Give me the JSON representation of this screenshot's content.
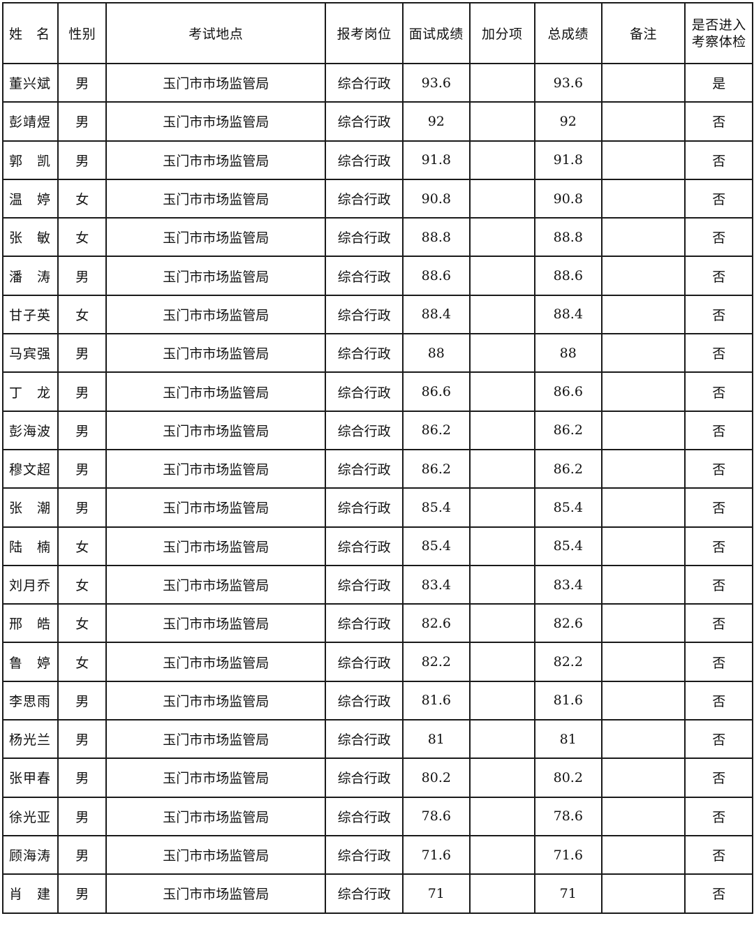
{
  "table": {
    "headers": [
      "姓　名",
      "性别",
      "考试地点",
      "报考岗位",
      "面试成绩",
      "加分项",
      "总成绩",
      "备注",
      "是否进入考察体检"
    ],
    "rows": [
      {
        "name": "董兴斌",
        "gender": "男",
        "location": "玉门市市场监管局",
        "position": "综合行政",
        "interview": "93.6",
        "bonus": "",
        "total": "93.6",
        "note": "",
        "proceed": "是"
      },
      {
        "name": "彭靖煜",
        "gender": "男",
        "location": "玉门市市场监管局",
        "position": "综合行政",
        "interview": "92",
        "bonus": "",
        "total": "92",
        "note": "",
        "proceed": "否"
      },
      {
        "name": "郭　凯",
        "gender": "男",
        "location": "玉门市市场监管局",
        "position": "综合行政",
        "interview": "91.8",
        "bonus": "",
        "total": "91.8",
        "note": "",
        "proceed": "否"
      },
      {
        "name": "温　婷",
        "gender": "女",
        "location": "玉门市市场监管局",
        "position": "综合行政",
        "interview": "90.8",
        "bonus": "",
        "total": "90.8",
        "note": "",
        "proceed": "否"
      },
      {
        "name": "张　敏",
        "gender": "女",
        "location": "玉门市市场监管局",
        "position": "综合行政",
        "interview": "88.8",
        "bonus": "",
        "total": "88.8",
        "note": "",
        "proceed": "否"
      },
      {
        "name": "潘　涛",
        "gender": "男",
        "location": "玉门市市场监管局",
        "position": "综合行政",
        "interview": "88.6",
        "bonus": "",
        "total": "88.6",
        "note": "",
        "proceed": "否"
      },
      {
        "name": "甘子英",
        "gender": "女",
        "location": "玉门市市场监管局",
        "position": "综合行政",
        "interview": "88.4",
        "bonus": "",
        "total": "88.4",
        "note": "",
        "proceed": "否"
      },
      {
        "name": "马宾强",
        "gender": "男",
        "location": "玉门市市场监管局",
        "position": "综合行政",
        "interview": "88",
        "bonus": "",
        "total": "88",
        "note": "",
        "proceed": "否"
      },
      {
        "name": "丁　龙",
        "gender": "男",
        "location": "玉门市市场监管局",
        "position": "综合行政",
        "interview": "86.6",
        "bonus": "",
        "total": "86.6",
        "note": "",
        "proceed": "否"
      },
      {
        "name": "彭海波",
        "gender": "男",
        "location": "玉门市市场监管局",
        "position": "综合行政",
        "interview": "86.2",
        "bonus": "",
        "total": "86.2",
        "note": "",
        "proceed": "否"
      },
      {
        "name": "穆文超",
        "gender": "男",
        "location": "玉门市市场监管局",
        "position": "综合行政",
        "interview": "86.2",
        "bonus": "",
        "total": "86.2",
        "note": "",
        "proceed": "否"
      },
      {
        "name": "张　潮",
        "gender": "男",
        "location": "玉门市市场监管局",
        "position": "综合行政",
        "interview": "85.4",
        "bonus": "",
        "total": "85.4",
        "note": "",
        "proceed": "否"
      },
      {
        "name": "陆　楠",
        "gender": "女",
        "location": "玉门市市场监管局",
        "position": "综合行政",
        "interview": "85.4",
        "bonus": "",
        "total": "85.4",
        "note": "",
        "proceed": "否"
      },
      {
        "name": "刘月乔",
        "gender": "女",
        "location": "玉门市市场监管局",
        "position": "综合行政",
        "interview": "83.4",
        "bonus": "",
        "total": "83.4",
        "note": "",
        "proceed": "否"
      },
      {
        "name": "邢　皓",
        "gender": "女",
        "location": "玉门市市场监管局",
        "position": "综合行政",
        "interview": "82.6",
        "bonus": "",
        "total": "82.6",
        "note": "",
        "proceed": "否"
      },
      {
        "name": "鲁　婷",
        "gender": "女",
        "location": "玉门市市场监管局",
        "position": "综合行政",
        "interview": "82.2",
        "bonus": "",
        "total": "82.2",
        "note": "",
        "proceed": "否"
      },
      {
        "name": "李思雨",
        "gender": "男",
        "location": "玉门市市场监管局",
        "position": "综合行政",
        "interview": "81.6",
        "bonus": "",
        "total": "81.6",
        "note": "",
        "proceed": "否"
      },
      {
        "name": "杨光兰",
        "gender": "男",
        "location": "玉门市市场监管局",
        "position": "综合行政",
        "interview": "81",
        "bonus": "",
        "total": "81",
        "note": "",
        "proceed": "否"
      },
      {
        "name": "张甲春",
        "gender": "男",
        "location": "玉门市市场监管局",
        "position": "综合行政",
        "interview": "80.2",
        "bonus": "",
        "total": "80.2",
        "note": "",
        "proceed": "否"
      },
      {
        "name": "徐光亚",
        "gender": "男",
        "location": "玉门市市场监管局",
        "position": "综合行政",
        "interview": "78.6",
        "bonus": "",
        "total": "78.6",
        "note": "",
        "proceed": "否"
      },
      {
        "name": "顾海涛",
        "gender": "男",
        "location": "玉门市市场监管局",
        "position": "综合行政",
        "interview": "71.6",
        "bonus": "",
        "total": "71.6",
        "note": "",
        "proceed": "否"
      },
      {
        "name": "肖　建",
        "gender": "男",
        "location": "玉门市市场监管局",
        "position": "综合行政",
        "interview": "71",
        "bonus": "",
        "total": "71",
        "note": "",
        "proceed": "否"
      }
    ]
  }
}
